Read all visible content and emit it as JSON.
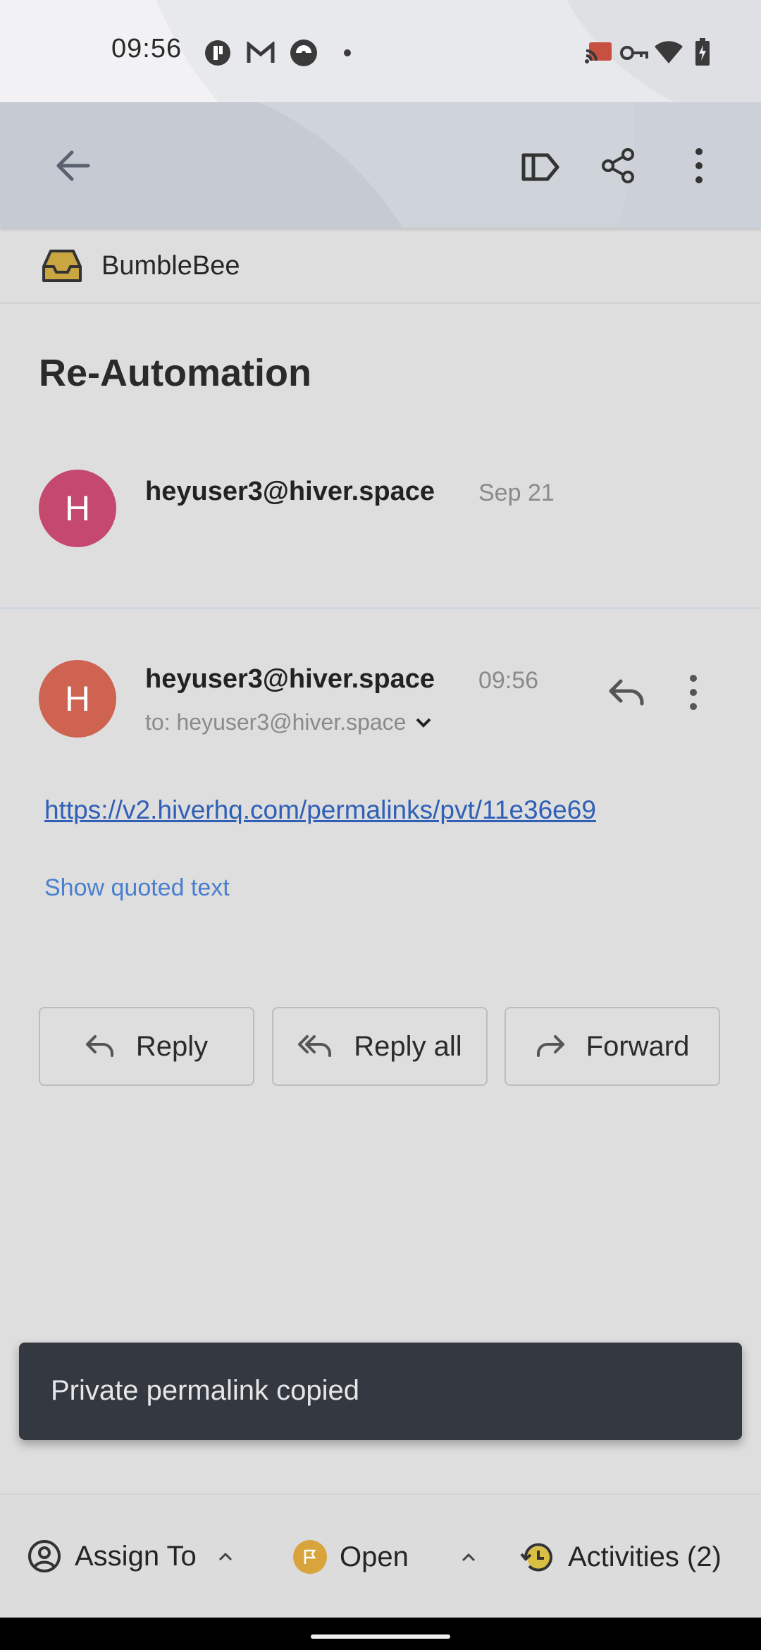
{
  "status_bar": {
    "time": "09:56"
  },
  "toolbar": {
    "back_icon": "arrow-left-icon",
    "label_icon": "label-icon",
    "share_icon": "share-icon",
    "more_icon": "more-vert-icon"
  },
  "inbox": {
    "name": "BumbleBee",
    "icon": "inbox-tray-icon",
    "icon_color": "#c9a640"
  },
  "subject": "Re-Automation",
  "messages": [
    {
      "avatar_letter": "H",
      "avatar_color": "#c5496f",
      "sender": "heyuser3@hiver.space",
      "date": "Sep 21"
    },
    {
      "avatar_letter": "H",
      "avatar_color": "#cf6352",
      "sender": "heyuser3@hiver.space",
      "date": "09:56",
      "recipients": "to: heyuser3@hiver.space",
      "body_link": "https://v2.hiverhq.com/permalinks/pvt/11e36e69",
      "show_quoted": "Show quoted text"
    }
  ],
  "actions": {
    "reply": "Reply",
    "reply_all": "Reply all",
    "forward": "Forward"
  },
  "toast": "Private permalink copied",
  "bottom_bar": {
    "assign": "Assign To",
    "status": "Open",
    "activities": "Activities (2)",
    "status_color": "#d9a43c"
  },
  "colors": {
    "link": "#2f5fb6",
    "link_light": "#4a7fd0",
    "toast_bg": "#343941"
  }
}
